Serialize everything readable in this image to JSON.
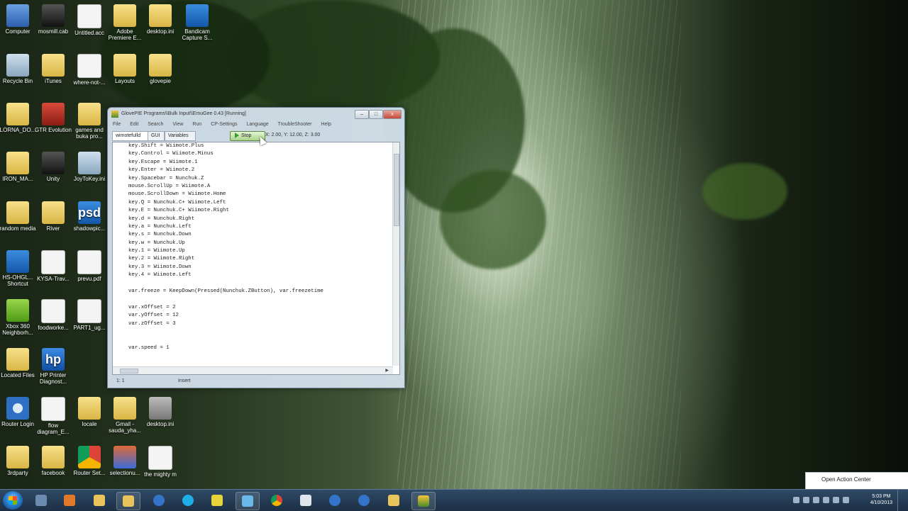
{
  "desktop": {
    "icons": [
      {
        "label": "Computer",
        "glyph": "",
        "name": "computer-icon"
      },
      {
        "label": "Recycle Bin",
        "glyph": "",
        "name": "recycle-bin-icon"
      },
      {
        "label": "LORNA_DO...",
        "glyph": "",
        "name": "folder-icon"
      },
      {
        "label": "IRON_MA...",
        "glyph": "",
        "name": "folder-icon"
      },
      {
        "label": "random media",
        "glyph": "",
        "name": "folder-icon"
      },
      {
        "label": "HS-OHGL... Shortcut",
        "glyph": "",
        "name": "shortcut-icon"
      },
      {
        "label": "Xbox 360 Neighborh...",
        "glyph": "",
        "name": "xbox-icon"
      },
      {
        "label": "Located Files",
        "glyph": "",
        "name": "folder-icon"
      },
      {
        "label": "Router Login",
        "glyph": "",
        "name": "gear-icon"
      },
      {
        "label": "3rdparty",
        "glyph": "",
        "name": "folder-icon"
      },
      {
        "label": "mosmill.cab",
        "glyph": "",
        "name": "cab-file-icon"
      },
      {
        "label": "iTunes",
        "glyph": "",
        "name": "folder-icon"
      },
      {
        "label": "GTR Evolution",
        "glyph": "",
        "name": "game-icon"
      },
      {
        "label": "Unity",
        "glyph": "",
        "name": "unity-icon"
      },
      {
        "label": "River",
        "glyph": "",
        "name": "folder-icon"
      },
      {
        "label": "KYSA-Trav...",
        "glyph": "",
        "name": "document-icon"
      },
      {
        "label": "foodworke...",
        "glyph": "",
        "name": "document-icon"
      },
      {
        "label": "HP Printer Diagnost...",
        "glyph": "hp",
        "name": "hp-printer-icon"
      },
      {
        "label": "flow diagram_E...",
        "glyph": "",
        "name": "document-icon"
      },
      {
        "label": "facebook",
        "glyph": "",
        "name": "folder-icon"
      },
      {
        "label": "Untitled.acc",
        "glyph": "",
        "name": "document-icon"
      },
      {
        "label": "where-not-...",
        "glyph": "",
        "name": "document-icon"
      },
      {
        "label": "games and buka pro...",
        "glyph": "",
        "name": "folder-icon"
      },
      {
        "label": "JoyToKey.ini",
        "glyph": "",
        "name": "settings-file-icon"
      },
      {
        "label": "shadowpic...",
        "glyph": "psd",
        "name": "psd-file-icon"
      },
      {
        "label": "prevu.pdf",
        "glyph": "",
        "name": "pdf-file-icon"
      },
      {
        "label": "PART1_ug...",
        "glyph": "",
        "name": "document-icon"
      },
      {
        "label": "locale",
        "glyph": "",
        "name": "folder-icon"
      },
      {
        "label": "Router Set...",
        "glyph": "",
        "name": "chrome-icon"
      },
      {
        "label": "Adobe Premiere E...",
        "glyph": "",
        "name": "folder-icon"
      },
      {
        "label": "Layouts",
        "glyph": "",
        "name": "folder-icon"
      },
      {
        "label": "Gmail - sauda_yha...",
        "glyph": "",
        "name": "document-icon"
      },
      {
        "label": "selectionu...",
        "glyph": "",
        "name": "app-icon"
      },
      {
        "label": "desktop.ini",
        "glyph": "",
        "name": "settings-file-icon"
      },
      {
        "label": "glovepie",
        "glyph": "",
        "name": "folder-icon"
      },
      {
        "label": "desktop.ini",
        "glyph": "",
        "name": "settings-file-icon"
      },
      {
        "label": "the mighty m",
        "glyph": "",
        "name": "folder-icon"
      },
      {
        "label": "Bandicam Capture S...",
        "glyph": "",
        "name": "capture-file-icon"
      }
    ]
  },
  "window": {
    "title": "GlovePIE  Programs\\\\Bulk Input\\\\EmuGee 0.43 [Running]",
    "controls": {
      "minimize": "–",
      "maximize": "□",
      "close": "x"
    },
    "menu": [
      "File",
      "Edit",
      "Search",
      "View",
      "Run",
      "CP-Settings",
      "Language",
      "TroubleShooter",
      "Help"
    ],
    "tabs": {
      "script": "wimotefulld",
      "gui": "GUI",
      "variables": "Variables"
    },
    "run_label": "Stop",
    "coords": "X: 2.00, Y: 12.00, Z: 3.00",
    "code_lines": [
      "key.Shift = Wiimote.Plus",
      "key.Control = Wiimote.Minus",
      "key.Escape = Wiimote.1",
      "key.Enter = Wiimote.2",
      "key.Spacebar = Nunchuk.Z",
      "mouse.ScrollUp = Wiimote.A",
      "mouse.ScrollDown = Wiimote.Home",
      "key.Q = Nunchuk.C+ Wiimote.Left",
      "key.E = Nunchuk.C+ Wiimote.Right",
      "key.d = Nunchuk.Right",
      "key.a = Nunchuk.Left",
      "key.s = Nunchuk.Down",
      "key.w = Nunchuk.Up",
      "key.1 = Wiimote.Up",
      "key.2 = Wiimote.Right",
      "key.3 = Wiimote.Down",
      "key.4 = Wiimote.Left",
      "",
      "var.freeze = KeepDown(Pressed(Nunchuk.ZButton), var.freezetime",
      "",
      "var.xOffset = 2",
      "var.yOffset = 12",
      "var.zOffset = 3",
      "",
      "",
      "var.speed = 1"
    ],
    "code_comment_lines": [
      17,
      24
    ],
    "status_position": "1: 1",
    "status_mode": "Insert"
  },
  "action_center": {
    "label": "Open Action Center"
  },
  "taskbar": {
    "clock_time": "5:03 PM",
    "clock_date": "4/10/2013"
  }
}
